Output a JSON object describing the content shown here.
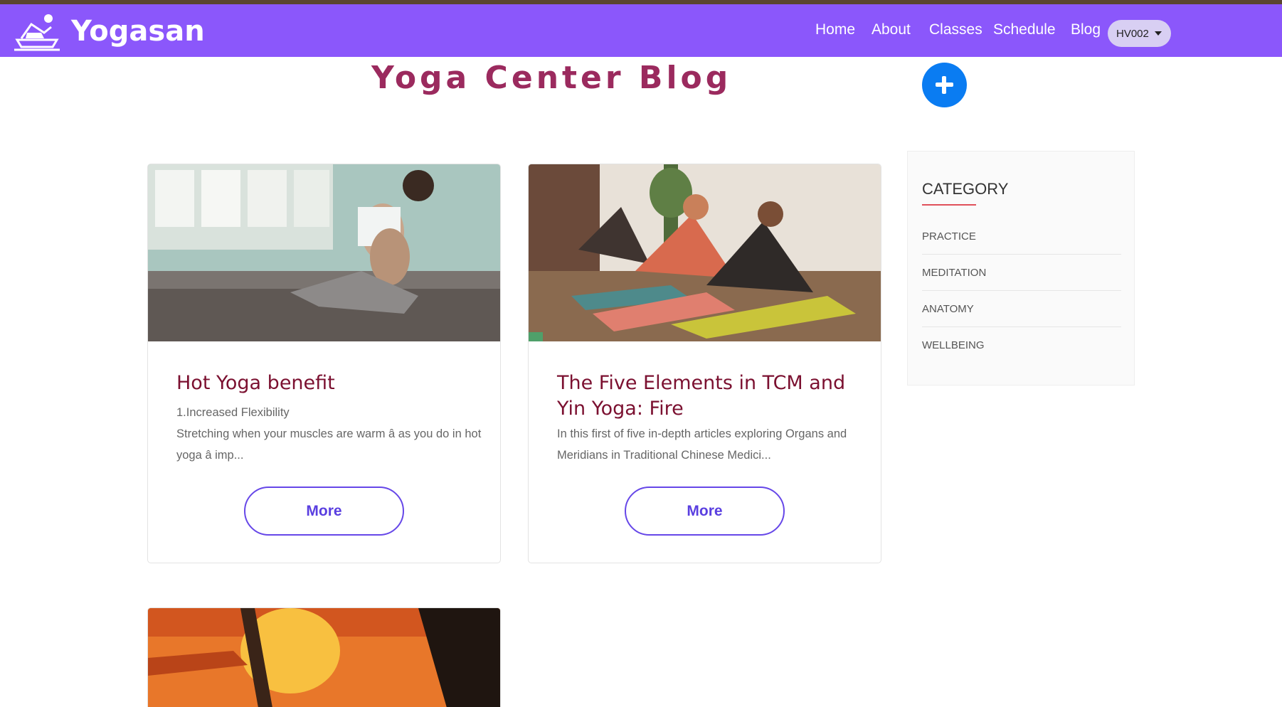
{
  "navbar": {
    "brand_name": "Yogasan",
    "links": [
      "Home",
      "About",
      "Classes",
      "Schedule",
      "Blog"
    ],
    "user": "HV002",
    "background": "#8b57fb"
  },
  "page": {
    "title": "Yoga Center Blog"
  },
  "posts": [
    {
      "title": "Hot Yoga benefit",
      "excerpt_line1": "1.Increased Flexibility",
      "excerpt_line2": "Stretching when your muscles are warm â as you do in hot yoga â imp...",
      "more_label": "More"
    },
    {
      "title": "The Five Elements in TCM and Yin Yoga: Fire",
      "excerpt": "In this first of five in-depth articles exploring Organs and Meridians in Traditional Chinese Medici...",
      "more_label": "More"
    }
  ],
  "sidebar": {
    "heading": "CATEGORY",
    "items": [
      "PRACTICE",
      "MEDITATION",
      "ANATOMY",
      "WELLBEING"
    ]
  },
  "icons": {
    "brand": "yoga-boat-icon",
    "add": "plus-icon",
    "user_caret": "caret-down-icon"
  }
}
